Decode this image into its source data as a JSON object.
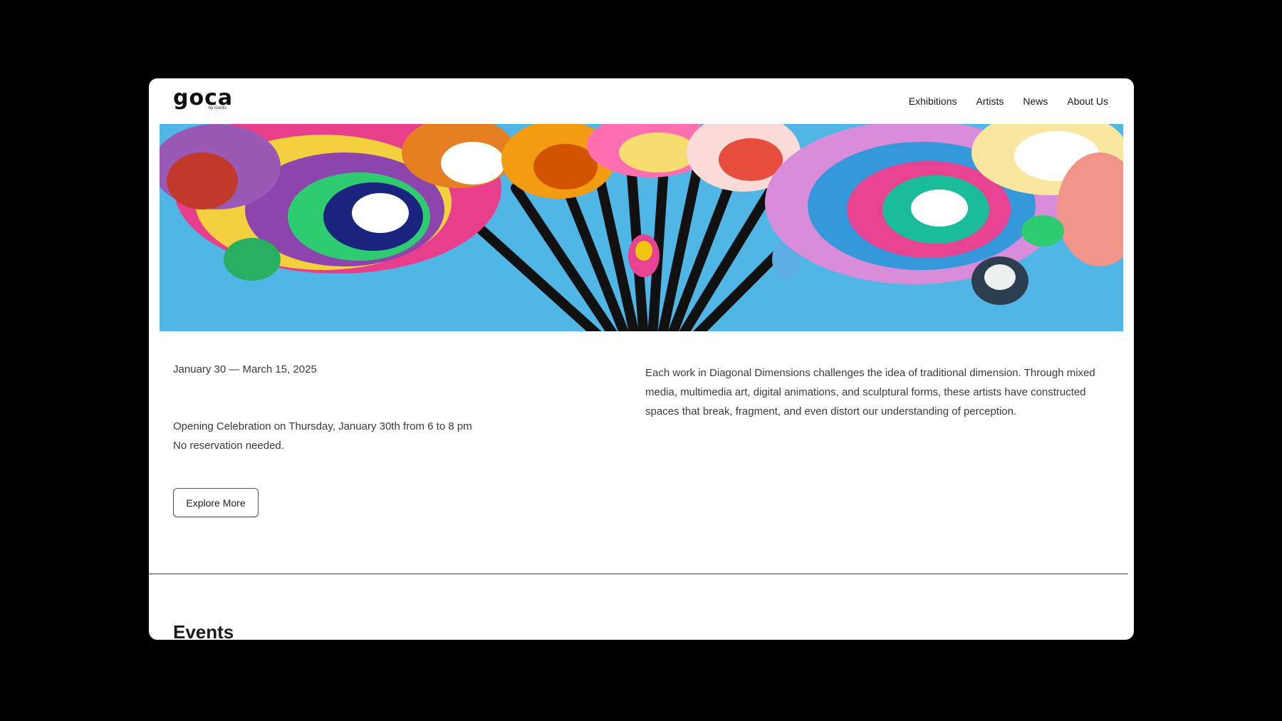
{
  "brand": {
    "logo_text": "goca",
    "logo_subtext": "by Gordo"
  },
  "nav": {
    "items": [
      {
        "label": "Exhibitions"
      },
      {
        "label": "Artists"
      },
      {
        "label": "News"
      },
      {
        "label": "About Us"
      }
    ]
  },
  "hero": {
    "icon": "artwork-banner"
  },
  "exhibition": {
    "dates": "January 30 — March 15, 2025",
    "opening_line1": "Opening Celebration on Thursday, January 30th from 6 to 8 pm",
    "opening_line2": "No reservation needed.",
    "description": "Each work in Diagonal Dimensions challenges the idea of traditional dimension. Through mixed media, multimedia art, digital animations, and sculptural forms, these artists have constructed spaces that break, fragment, and even distort our understanding of perception.",
    "explore_label": "Explore More"
  },
  "events": {
    "title": "Events"
  },
  "colors": {
    "background": "#000000",
    "page": "#ffffff",
    "sky": "#4fb6e6",
    "text": "#3a3a3a"
  }
}
